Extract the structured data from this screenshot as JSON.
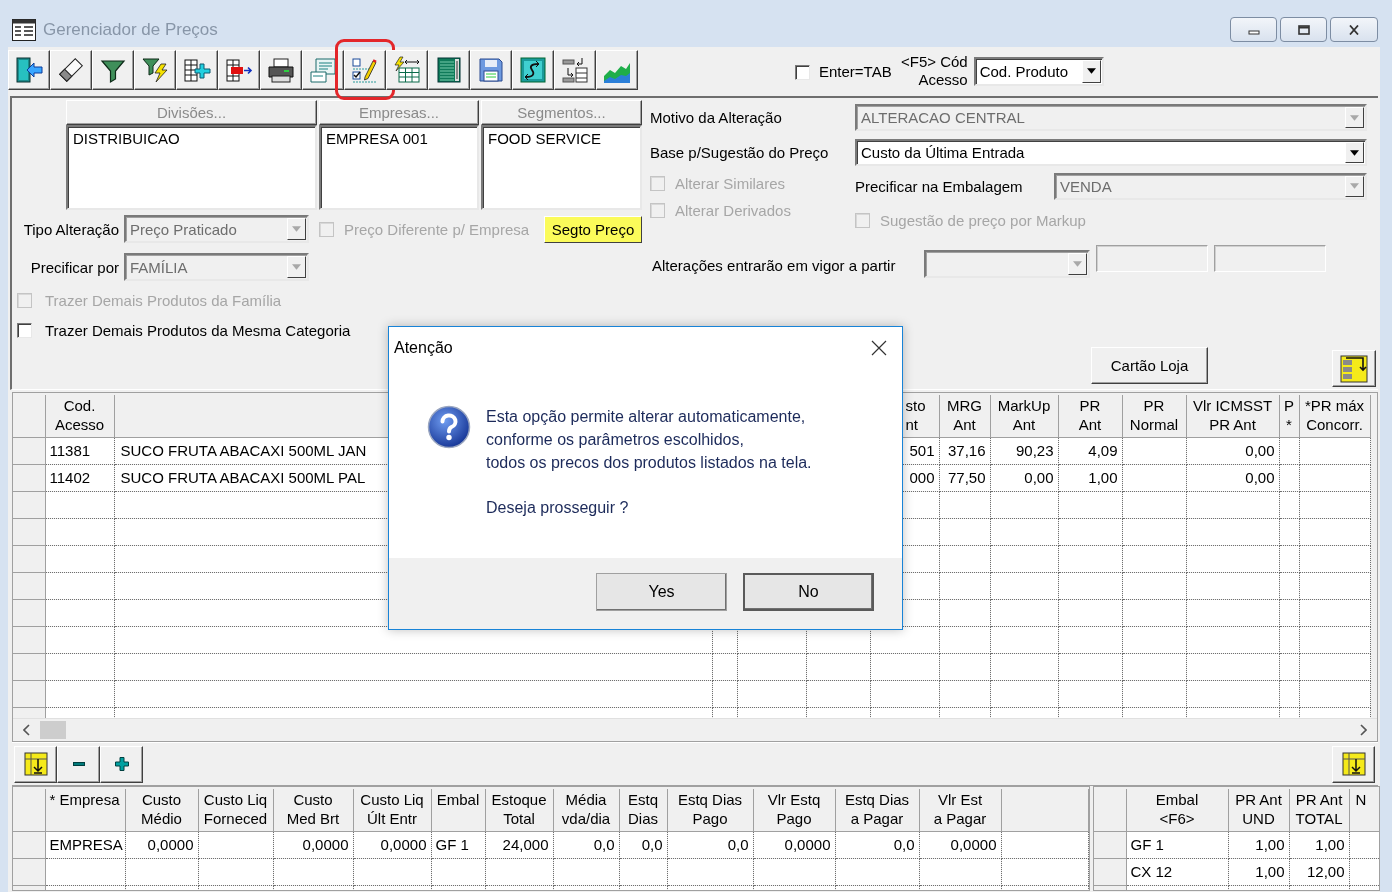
{
  "window": {
    "title": "Gerenciador de Preços"
  },
  "toolbar": {
    "buttons": [
      {
        "highlighted": false
      },
      {
        "highlighted": false
      },
      {
        "highlighted": false
      },
      {
        "highlighted": false
      },
      {
        "highlighted": false
      },
      {
        "highlighted": false
      },
      {
        "highlighted": false
      },
      {
        "highlighted": false
      },
      {
        "highlighted": true
      },
      {
        "highlighted": false
      },
      {
        "highlighted": false
      },
      {
        "highlighted": false
      },
      {
        "highlighted": false
      },
      {
        "highlighted": false
      },
      {
        "highlighted": false
      }
    ],
    "enter_tab": {
      "label": "Enter=TAB",
      "checked": false
    },
    "code_label": "<F5> Cód Acesso",
    "code_field": {
      "value": "Cod. Produto"
    }
  },
  "selectors": [
    {
      "header": "Divisões...",
      "disabled": true,
      "items": [
        "DISTRIBUICAO"
      ]
    },
    {
      "header": "Empresas...",
      "disabled": true,
      "items": [
        "EMPRESA 001"
      ]
    },
    {
      "header": "Segmentos...",
      "disabled": true,
      "items": [
        "FOOD SERVICE"
      ]
    }
  ],
  "tipo_alteracao": {
    "label": "Tipo Alteração",
    "value": "Preço Praticado",
    "disabled": true
  },
  "preco_diferente": {
    "label": "Preço Diferente p/ Empresa",
    "checked": false,
    "disabled": true
  },
  "segto_preco_button": {
    "label": "Segto Preço"
  },
  "precificar_por": {
    "label": "Precificar por",
    "value": "FAMÍLIA",
    "disabled": true
  },
  "trazer_options": [
    {
      "label": "Trazer Demais Produtos da Família",
      "checked": false,
      "disabled": true
    },
    {
      "label": "Trazer Demais Produtos da Mesma Categoria",
      "checked": false,
      "disabled": false
    }
  ],
  "motivo": {
    "label": "Motivo da Alteração",
    "value": "ALTERACAO CENTRAL",
    "disabled": true
  },
  "base_sugestao": {
    "label": "Base p/Sugestão do Preço",
    "value": "Custo da Última Entrada",
    "disabled": false
  },
  "alterar_options": [
    {
      "label": "Alterar Similares",
      "checked": false,
      "disabled": true
    },
    {
      "label": "Alterar Derivados",
      "checked": false,
      "disabled": true
    }
  ],
  "embalagem": {
    "label": "Precificar na Embalagem",
    "value": "VENDA",
    "disabled": true
  },
  "markup_option": {
    "label": "Sugestão de preço por Markup",
    "checked": false,
    "disabled": true
  },
  "vigor": {
    "label": "Alterações entrarão em vigor a partir",
    "date": {
      "disabled": true
    },
    "fields": [
      {
        "disabled": true
      },
      {
        "disabled": true
      }
    ]
  },
  "cartao_loja_button": {
    "label": "Cartão Loja"
  },
  "price_grid": {
    "columns": [
      "Cod.\nAcesso",
      null,
      null,
      null,
      null,
      "sto\nnt",
      "MRG\nAnt",
      "MarkUp\nAnt",
      "PR\nAnt",
      "PR\nNormal",
      "Vlr ICMSST\nPR Ant",
      "P\n*",
      "*PR máx\nConcorr."
    ],
    "rows": [
      [
        "11381",
        "SUCO FRUTA ABACAXI 500ML JAN",
        null,
        null,
        null,
        "501",
        "37,16",
        "90,23",
        "4,09",
        null,
        "0,00",
        null,
        null
      ],
      [
        "11402",
        "SUCO FRUTA ABACAXI 500ML PAL",
        null,
        null,
        null,
        "000",
        "77,50",
        "0,00",
        "1,00",
        null,
        "0,00",
        null,
        null
      ]
    ]
  },
  "stock_grid": {
    "columns": [
      "* Empresa",
      "Custo\nMédio",
      "Custo Liq\nForneced",
      "Custo\nMed Brt",
      "Custo Liq\nÚlt Entr",
      "Embal",
      "Estoque\nTotal",
      "Média\nvda/dia",
      "Estq\nDias",
      "Estq Dias\nPago",
      "Vlr Estq\nPago",
      "Estq Dias\na Pagar",
      "Vlr Est\na Pagar",
      null
    ],
    "rows": [
      [
        "EMPRESA",
        "0,0000",
        null,
        "0,0000",
        "0,0000",
        "GF 1",
        "24,000",
        "0,0",
        "0,0",
        "0,0",
        "0,0000",
        "0,0",
        "0,0000",
        null
      ]
    ]
  },
  "package_grid": {
    "columns": [
      "Embal\n<F6>",
      "PR Ant\nUND",
      "PR Ant\nTOTAL",
      "N"
    ],
    "rows": [
      [
        "GF 1",
        "1,00",
        "1,00",
        null
      ],
      [
        "CX 12",
        "1,00",
        "12,00",
        null
      ]
    ]
  },
  "dialog": {
    "title": "Atenção",
    "message": "Esta opção permite alterar automaticamente,\nconforme os parâmetros escolhidos,\ntodos os precos dos produtos listados na tela.",
    "prompt": "Deseja prosseguir ?",
    "buttons": [
      {
        "label": "Yes",
        "focused": false
      },
      {
        "label": "No",
        "focused": true
      }
    ]
  }
}
